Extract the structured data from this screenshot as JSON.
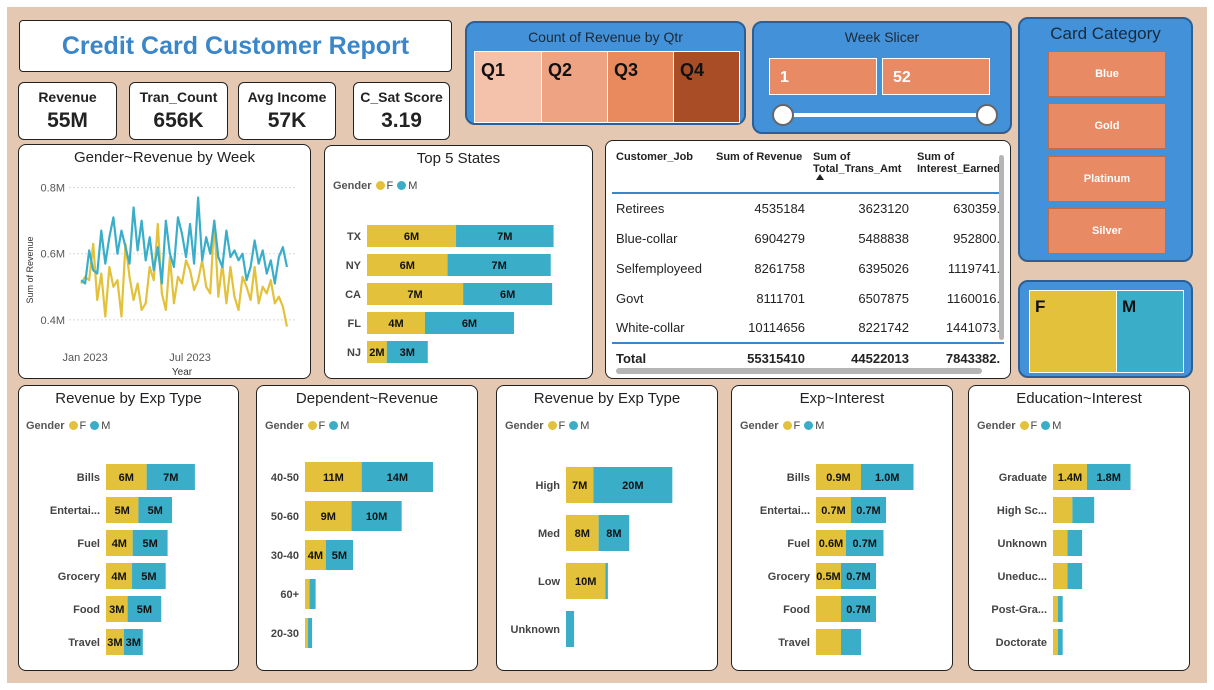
{
  "header": {
    "title": "Credit Card Customer Report"
  },
  "kpis": [
    {
      "label": "Revenue",
      "value": "55M"
    },
    {
      "label": "Tran_Count",
      "value": "656K"
    },
    {
      "label": "Avg Income",
      "value": "57K"
    },
    {
      "label": "C_Sat Score",
      "value": "3.19"
    }
  ],
  "qtr": {
    "title": "Count of Revenue by Qtr",
    "cells": [
      {
        "label": "Q1",
        "color": "#f4c2aa"
      },
      {
        "label": "Q2",
        "color": "#eea383"
      },
      {
        "label": "Q3",
        "color": "#e88a5e"
      },
      {
        "label": "Q4",
        "color": "#a94d27"
      }
    ]
  },
  "week_slicer": {
    "title": "Week Slicer",
    "min": "1",
    "max": "52"
  },
  "card_category": {
    "title": "Card Category",
    "items": [
      "Blue",
      "Gold",
      "Platinum",
      "Silver"
    ]
  },
  "gender_treemap": {
    "f_label": "F",
    "m_label": "M",
    "f_share": 0.56
  },
  "colors": {
    "female": "#e3c13a",
    "male": "#3aaec9",
    "accent": "#3a86c9"
  },
  "legend": {
    "title": "Gender",
    "f": "F",
    "m": "M"
  },
  "jobs_table": {
    "columns": [
      "Customer_Job",
      "Sum of Revenue",
      "Sum of Total_Trans_Amt",
      "Sum of Interest_Earned"
    ],
    "rows": [
      [
        "Retirees",
        "4535184",
        "3623120",
        "630359."
      ],
      [
        "Blue-collar",
        "6904279",
        "5488838",
        "952800."
      ],
      [
        "Selfemployeed",
        "8261758",
        "6395026",
        "1119741."
      ],
      [
        "Govt",
        "8111701",
        "6507875",
        "1160016."
      ],
      [
        "White-collar",
        "10114656",
        "8221742",
        "1441073."
      ]
    ],
    "total": [
      "Total",
      "55315410",
      "44522013",
      "7843382."
    ]
  },
  "chart_data": [
    {
      "id": "gender_revenue_week",
      "type": "line",
      "title": "Gender~Revenue by Week",
      "xlabel": "Year",
      "ylabel": "Sum of Revenue",
      "x_ticks": [
        "Jan 2023",
        "Jul 2023"
      ],
      "x_tick_positions": [
        1,
        27
      ],
      "y_ticks": [
        {
          "v": 0.4,
          "label": "0.4M"
        },
        {
          "v": 0.6,
          "label": "0.6M"
        },
        {
          "v": 0.8,
          "label": "0.8M"
        }
      ],
      "ylim": [
        0.33,
        0.82
      ],
      "xlim": [
        -3,
        53
      ],
      "series": [
        {
          "name": "F",
          "values": [
            0.51,
            0.53,
            0.52,
            0.63,
            0.46,
            0.54,
            0.41,
            0.56,
            0.5,
            0.52,
            0.41,
            0.63,
            0.53,
            0.46,
            0.51,
            0.43,
            0.45,
            0.56,
            0.52,
            0.69,
            0.48,
            0.43,
            0.59,
            0.45,
            0.53,
            0.51,
            0.58,
            0.55,
            0.49,
            0.52,
            0.58,
            0.5,
            0.48,
            0.7,
            0.47,
            0.57,
            0.45,
            0.56,
            0.47,
            0.43,
            0.53,
            0.5,
            0.46,
            0.56,
            0.45,
            0.5,
            0.48,
            0.52,
            0.45,
            0.47,
            0.44,
            0.38
          ]
        },
        {
          "name": "M",
          "values": [
            0.52,
            0.51,
            0.61,
            0.55,
            0.54,
            0.67,
            0.57,
            0.65,
            0.71,
            0.6,
            0.67,
            0.62,
            0.57,
            0.74,
            0.61,
            0.7,
            0.58,
            0.65,
            0.55,
            0.62,
            0.51,
            0.7,
            0.6,
            0.56,
            0.71,
            0.66,
            0.59,
            0.69,
            0.57,
            0.77,
            0.58,
            0.65,
            0.6,
            0.7,
            0.59,
            0.56,
            0.67,
            0.59,
            0.61,
            0.58,
            0.6,
            0.52,
            0.56,
            0.64,
            0.57,
            0.61,
            0.54,
            0.58,
            0.51,
            0.59,
            0.62,
            0.56
          ]
        }
      ]
    },
    {
      "id": "top5_states",
      "type": "bar",
      "stacked": true,
      "orientation": "horizontal",
      "title": "Top 5 States",
      "categories": [
        "TX",
        "NY",
        "CA",
        "FL",
        "NJ"
      ],
      "xlim": [
        0,
        15
      ],
      "series": [
        {
          "name": "F",
          "values": [
            6.3,
            5.7,
            6.8,
            4.1,
            1.4
          ],
          "labels": [
            "6M",
            "6M",
            "7M",
            "4M",
            "2M"
          ]
        },
        {
          "name": "M",
          "values": [
            6.9,
            7.3,
            6.3,
            6.3,
            2.9
          ],
          "labels": [
            "7M",
            "7M",
            "6M",
            "6M",
            "3M"
          ]
        }
      ]
    },
    {
      "id": "revenue_exp_type",
      "type": "bar",
      "stacked": true,
      "orientation": "horizontal",
      "title": "Revenue by Exp Type",
      "categories": [
        "Bills",
        "Entertai...",
        "Fuel",
        "Grocery",
        "Food",
        "Travel"
      ],
      "xlim": [
        0,
        20
      ],
      "series": [
        {
          "name": "F",
          "values": [
            6.4,
            5.1,
            4.2,
            4.1,
            3.4,
            2.8
          ],
          "labels": [
            "6M",
            "5M",
            "4M",
            "4M",
            "3M",
            "3M"
          ]
        },
        {
          "name": "M",
          "values": [
            7.6,
            5.3,
            5.5,
            5.3,
            5.3,
            3.0
          ],
          "labels": [
            "7M",
            "5M",
            "5M",
            "5M",
            "5M",
            "3M"
          ]
        }
      ]
    },
    {
      "id": "dependent_revenue",
      "type": "bar",
      "stacked": true,
      "orientation": "horizontal",
      "title": "Dependent~Revenue",
      "categories": [
        "40-50",
        "50-60",
        "30-40",
        "60+",
        "20-30"
      ],
      "xlim": [
        0,
        33
      ],
      "series": [
        {
          "name": "F",
          "values": [
            11.2,
            9.2,
            4.1,
            0.9,
            0.6
          ],
          "labels": [
            "11M",
            "9M",
            "4M",
            "",
            ""
          ]
        },
        {
          "name": "M",
          "values": [
            14.1,
            9.9,
            5.4,
            1.2,
            0.8
          ],
          "labels": [
            "14M",
            "10M",
            "5M",
            "",
            ""
          ]
        }
      ]
    },
    {
      "id": "revenue_income_level",
      "type": "bar",
      "stacked": true,
      "orientation": "horizontal",
      "title": "Revenue by Exp Type",
      "categories": [
        "High",
        "Med",
        "Low",
        "Unknown"
      ],
      "xlim": [
        0,
        36
      ],
      "series": [
        {
          "name": "F",
          "values": [
            6.8,
            8.1,
            9.8,
            0
          ],
          "labels": [
            "7M",
            "8M",
            "10M",
            ""
          ]
        },
        {
          "name": "M",
          "values": [
            19.6,
            7.6,
            0.6,
            2.0
          ],
          "labels": [
            "20M",
            "8M",
            "",
            ""
          ]
        }
      ]
    },
    {
      "id": "exp_interest",
      "type": "bar",
      "stacked": true,
      "orientation": "horizontal",
      "title": "Exp~Interest",
      "categories": [
        "Bills",
        "Entertai...",
        "Fuel",
        "Grocery",
        "Food",
        "Travel"
      ],
      "xlim": [
        0,
        2.5
      ],
      "series": [
        {
          "name": "F",
          "values": [
            0.9,
            0.7,
            0.6,
            0.5,
            0.5,
            0.5
          ],
          "labels": [
            "0.9M",
            "0.7M",
            "0.6M",
            "0.5M",
            "",
            ""
          ]
        },
        {
          "name": "M",
          "values": [
            1.05,
            0.7,
            0.75,
            0.7,
            0.7,
            0.4
          ],
          "labels": [
            "1.0M",
            "0.7M",
            "0.7M",
            "0.7M",
            "0.7M",
            ""
          ]
        }
      ]
    },
    {
      "id": "education_interest",
      "type": "bar",
      "stacked": true,
      "orientation": "horizontal",
      "title": "Education~Interest",
      "categories": [
        "Graduate",
        "High Sc...",
        "Unknown",
        "Uneduc...",
        "Post-Gra...",
        "Doctorate"
      ],
      "xlim": [
        0,
        5.2
      ],
      "series": [
        {
          "name": "F",
          "values": [
            1.4,
            0.8,
            0.6,
            0.6,
            0.2,
            0.2
          ],
          "labels": [
            "1.4M",
            "",
            "",
            "",
            "",
            ""
          ]
        },
        {
          "name": "M",
          "values": [
            1.8,
            0.9,
            0.6,
            0.6,
            0.2,
            0.2
          ],
          "labels": [
            "1.8M",
            "",
            "",
            "",
            "",
            ""
          ]
        }
      ]
    }
  ]
}
